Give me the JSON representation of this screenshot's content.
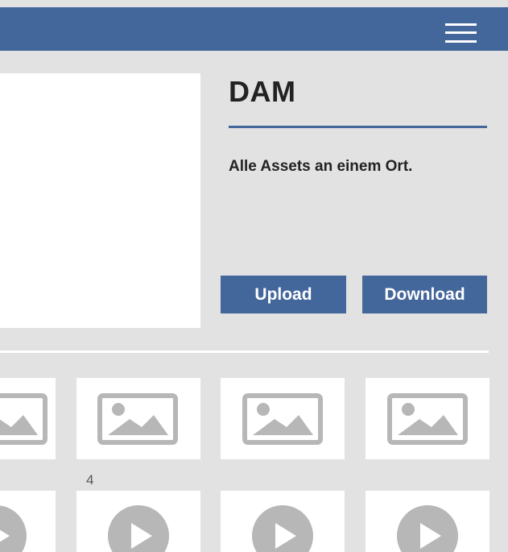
{
  "header": {
    "menu_icon": "hamburger-menu-icon",
    "bar_color": "#43669b"
  },
  "intro": {
    "title": "DAM",
    "tagline": "Alle Assets an einem Ort.",
    "upload_label": "Upload",
    "download_label": "Download"
  },
  "gallery": {
    "image_icon": "image-placeholder-icon",
    "video_icon": "play-icon",
    "group_count": "4"
  },
  "colors": {
    "accent": "#43669b",
    "background": "#e2e2e2",
    "icon_gray": "#b7b7b7"
  }
}
